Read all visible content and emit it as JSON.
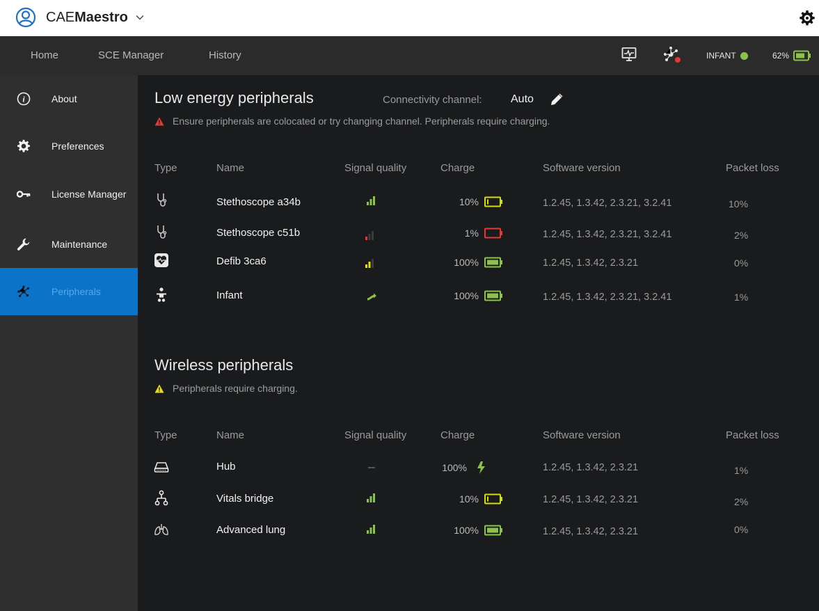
{
  "titlebar": {
    "brand_prefix": "CAE",
    "brand_bold": "Maestro"
  },
  "nav": {
    "items": [
      "Home",
      "SCE Manager",
      "History"
    ],
    "mode_label": "INFANT",
    "battery_label": "62%"
  },
  "sidebar": {
    "items": [
      {
        "label": "About",
        "icon": "info-icon"
      },
      {
        "label": "Preferences",
        "icon": "gear-icon"
      },
      {
        "label": "License Manager",
        "icon": "key-icon"
      },
      {
        "label": "Maintenance",
        "icon": "wrench-icon"
      },
      {
        "label": "Peripherals",
        "icon": "peripherals-icon",
        "active": true
      }
    ]
  },
  "low_energy": {
    "title": "Low energy peripherals",
    "channel_label": "Connectivity channel:",
    "channel_value": "Auto",
    "warning": "Ensure peripherals are colocated or try changing channel. Peripherals require charging.",
    "columns": [
      "Type",
      "Name",
      "Signal quality",
      "Charge",
      "Software version",
      "Packet loss"
    ],
    "rows": [
      {
        "type": "stethoscope-icon",
        "name": "Stethoscope a34b",
        "signal": "good",
        "charge": "10%",
        "battery": "low",
        "software": "1.2.45, 1.3.42, 2.3.21, 3.2.41",
        "packet_loss": "10%"
      },
      {
        "type": "stethoscope-icon",
        "name": "Stethoscope c51b",
        "signal": "poor",
        "charge": "1%",
        "battery": "critical",
        "software": "1.2.45, 1.3.42, 2.3.21, 3.2.41",
        "packet_loss": "2%"
      },
      {
        "type": "defib-icon",
        "name": "Defib 3ca6",
        "signal": "fair",
        "charge": "100%",
        "battery": "full",
        "software": "1.2.45, 1.3.42, 2.3.21",
        "packet_loss": "0%"
      },
      {
        "type": "infant-icon",
        "name": "Infant",
        "signal": "wired",
        "charge": "100%",
        "battery": "full",
        "software": "1.2.45, 1.3.42, 2.3.21, 3.2.41",
        "packet_loss": "1%"
      }
    ]
  },
  "wireless": {
    "title": "Wireless peripherals",
    "warning": "Peripherals require charging.",
    "columns": [
      "Type",
      "Name",
      "Signal quality",
      "Charge",
      "Software version",
      "Packet loss"
    ],
    "rows": [
      {
        "type": "hub-icon",
        "name": "Hub",
        "signal": "none",
        "charge": "100%",
        "battery": "charging",
        "software": "1.2.45, 1.3.42, 2.3.21",
        "packet_loss": "1%"
      },
      {
        "type": "vitals-bridge-icon",
        "name": "Vitals bridge",
        "signal": "good",
        "charge": "10%",
        "battery": "low",
        "software": "1.2.45, 1.3.42, 2.3.21",
        "packet_loss": "2%"
      },
      {
        "type": "lung-icon",
        "name": "Advanced lung",
        "signal": "good",
        "charge": "100%",
        "battery": "full",
        "software": "1.2.45, 1.3.42, 2.3.21",
        "packet_loss": "0%"
      }
    ]
  },
  "colors": {
    "accent": "#0b74c9",
    "ok": "#8bc34a",
    "warn": "#e8e010",
    "danger": "#e53935",
    "battery_low": "#d4e000"
  }
}
